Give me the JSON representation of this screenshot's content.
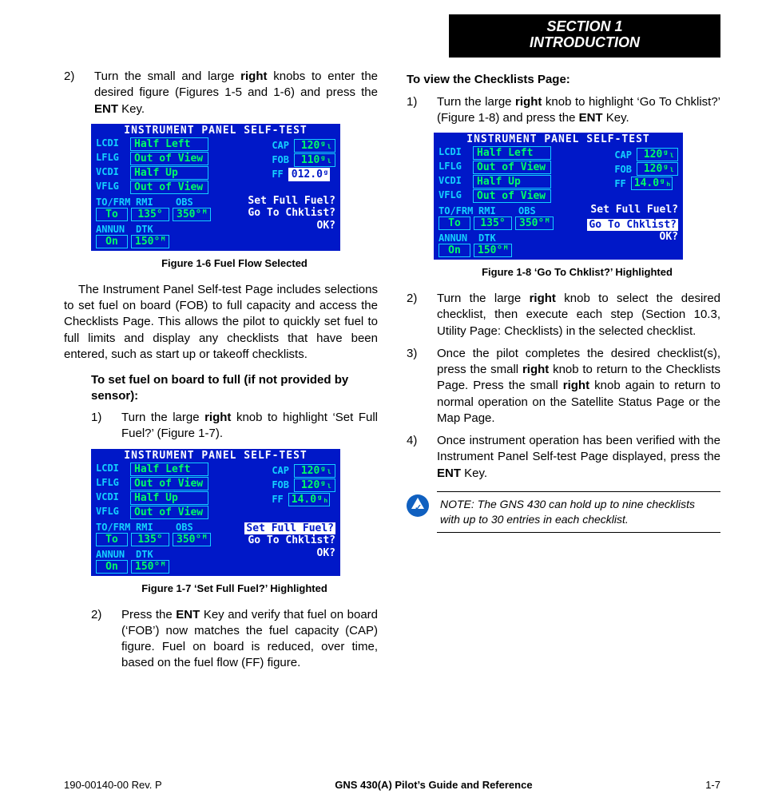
{
  "header": {
    "line1": "SECTION 1",
    "line2": "INTRODUCTION"
  },
  "left": {
    "step2": {
      "n": "2)",
      "pre": "Turn the small and large ",
      "b1": "right",
      "mid": " knobs to enter the desired figure (Figures 1-5 and 1-6) and press the ",
      "b2": "ENT",
      "post": " Key."
    },
    "fig6_caption": "Figure 1-6  Fuel Flow Selected",
    "para": "The Instrument Panel Self-test Page includes selections to set fuel on board (FOB) to full capacity and access the Checklists Page.  This allows the pilot to quickly set fuel to full limits and display any checklists that have been entered, such as start up or takeoff checklists.",
    "sub1": "To set fuel on board to full (if not provided by sensor):",
    "s1_1": {
      "n": "1)",
      "pre": "Turn the large ",
      "b1": "right",
      "post": " knob to highlight ‘Set Full Fuel?’ (Figure 1-7)."
    },
    "fig7_caption": "Figure 1-7  ‘Set Full Fuel?’ Highlighted",
    "s1_2": {
      "n": "2)",
      "pre": "Press the ",
      "b1": "ENT",
      "post": " Key and verify that fuel on board (‘FOB’) now matches the fuel capacity (CAP) figure.  Fuel on board is reduced, over time, based on the fuel flow (FF) figure."
    }
  },
  "right": {
    "sub": "To view the Checklists Page:",
    "r1": {
      "n": "1)",
      "pre": "Turn the large ",
      "b1": "right",
      "mid": " knob to highlight ‘Go To Chklist?’ (Figure 1-8) and press the ",
      "b2": "ENT",
      "post": " Key."
    },
    "fig8_caption": "Figure 1-8  ‘Go To Chklist?’ Highlighted",
    "r2": {
      "n": "2)",
      "pre": "Turn the large ",
      "b1": "right",
      "post": " knob to select the desired checklist, then execute each step (Section 10.3, Utility Page: Checklists) in the selected checklist."
    },
    "r3": {
      "n": "3)",
      "pre": "Once the pilot completes the desired checklist(s), press the small ",
      "b1": "right",
      "mid": " knob to return to the Checklists Page.  Press the small ",
      "b2": "right",
      "post": " knob again to return to normal operation on the Satellite Status Page or the Map Page."
    },
    "r4": {
      "n": "4)",
      "pre": "Once instrument operation has been verified with the Instrument Panel Self-test Page displayed, press the ",
      "b1": "ENT",
      "post": " Key."
    },
    "note": "NOTE:  The GNS 430 can hold up to nine checklists with up to 30 entries in each checklist."
  },
  "panel": {
    "title": "INSTRUMENT PANEL SELF-TEST",
    "rows": [
      {
        "l": "LCDI",
        "v": "Half Left"
      },
      {
        "l": "LFLG",
        "v": "Out of View"
      },
      {
        "l": "VCDI",
        "v": "Half Up"
      },
      {
        "l": "VFLG",
        "v": "Out of View"
      }
    ],
    "rlabels": [
      "CAP",
      "FOB",
      "FF"
    ],
    "midlabels": [
      "TO/FRM",
      "RMI",
      "OBS"
    ],
    "botlabels": [
      "ANNUN",
      "DTK"
    ],
    "bot": [
      "On",
      "150°ᴹ"
    ],
    "prompts": [
      "Set Full Fuel?",
      "Go To Chklist?",
      "OK?"
    ]
  },
  "fig6": {
    "rvals": [
      "120ᵍₗ",
      "110ᵍₗ",
      "012.0ᵍₕ"
    ],
    "mid": [
      "To",
      "135°",
      "350°ᴹ"
    ],
    "highlight": "ff"
  },
  "fig7": {
    "rvals": [
      "120ᵍₗ",
      "120ᵍₗ",
      "14.0ᵍₕ"
    ],
    "mid": [
      "To",
      "135°",
      "350°ᴹ"
    ],
    "highlight": "set"
  },
  "fig8": {
    "rvals": [
      "120ᵍₗ",
      "120ᵍₗ",
      "14.0ᵍₕ"
    ],
    "mid": [
      "To",
      "135°",
      "350°ᴹ"
    ],
    "highlight": "go"
  },
  "footer": {
    "left": "190-00140-00  Rev. P",
    "mid": "GNS 430(A) Pilot’s Guide and Reference",
    "right": "1-7"
  }
}
